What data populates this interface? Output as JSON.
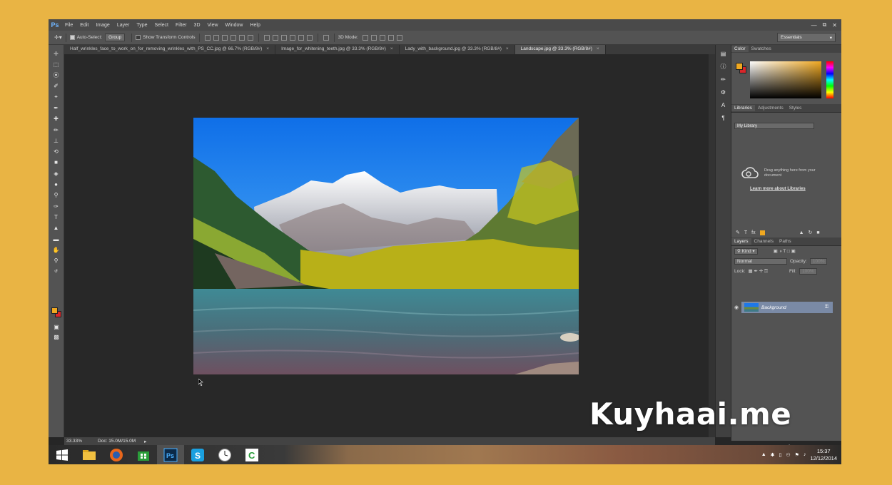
{
  "app": {
    "logo": "Ps",
    "menu": [
      "File",
      "Edit",
      "Image",
      "Layer",
      "Type",
      "Select",
      "Filter",
      "3D",
      "View",
      "Window",
      "Help"
    ]
  },
  "options": {
    "auto_select_label": "Auto-Select:",
    "auto_select_value": "Group",
    "show_transform_label": "Show Transform Controls",
    "mode_3d_label": "3D Mode:",
    "workspace": "Essentials"
  },
  "tabs": [
    {
      "label": "Half_wrinkles_face_to_work_on_for_removing_wrinkles_with_PS_CC.jpg @ 66.7% (RGB/8#)",
      "close": "×"
    },
    {
      "label": "Image_for_whitening_teeth.jpg @ 33.3% (RGB/8#)",
      "close": "×"
    },
    {
      "label": "Lady_with_background.jpg @ 33.3% (RGB/8#)",
      "close": "×"
    },
    {
      "label": "Landscape.jpg @ 33.3% (RGB/8#)",
      "close": "×"
    }
  ],
  "color_panel": {
    "tabs": [
      "Color",
      "Swatches"
    ],
    "foreground": "#f0a820",
    "background": "#d8262a"
  },
  "libraries_panel": {
    "tabs": [
      "Libraries",
      "Adjustments",
      "Styles"
    ],
    "library": "My Library",
    "drag_text": "Drag anything here from your document",
    "learn_more": "Learn more about Libraries"
  },
  "layers_panel": {
    "tabs": [
      "Layers",
      "Channels",
      "Paths"
    ],
    "filter": "Kind",
    "blend_mode": "Normal",
    "opacity_label": "Opacity:",
    "opacity_value": "100%",
    "lock_label": "Lock:",
    "fill_label": "Fill:",
    "fill_value": "100%",
    "layer_name": "Background"
  },
  "status": {
    "zoom": "33.33%",
    "doc": "Doc: 15.0M/15.0M"
  },
  "taskbar": {
    "time": "15:37",
    "date": "12/12/2014"
  },
  "watermark": "Kuyhaai.me"
}
